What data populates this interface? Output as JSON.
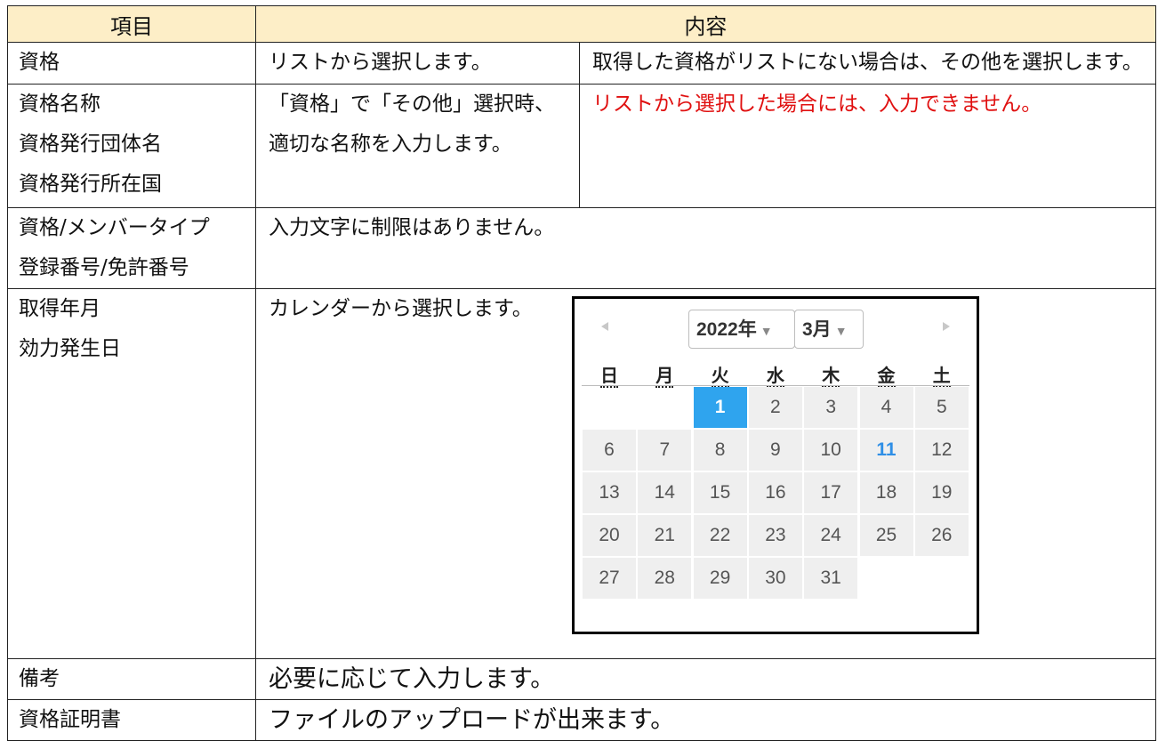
{
  "headers": {
    "item": "項目",
    "content": "内容"
  },
  "rows": {
    "qual": {
      "label": "資格",
      "desc": "リストから選択します。",
      "note": "取得した資格がリストにない場合は、その他を選択します。"
    },
    "names": {
      "labels": [
        "資格名称",
        "資格発行団体名",
        "資格発行所在国"
      ],
      "desc": [
        "「資格」で「その他」選択時、",
        "適切な名称を入力します。"
      ],
      "note": "リストから選択した場合には、入力できません。"
    },
    "member": {
      "labels": [
        "資格/メンバータイプ",
        "登録番号/免許番号"
      ],
      "desc": "入力文字に制限はありません。"
    },
    "date": {
      "labels": [
        "取得年月",
        "効力発生日"
      ],
      "desc": "カレンダーから選択します。"
    },
    "remarks": {
      "label": "備考",
      "desc": "必要に応じて入力します。"
    },
    "cert": {
      "label": "資格証明書",
      "desc": "ファイルのアップロードが出来ます。"
    }
  },
  "calendar": {
    "year": "2022年",
    "month": "3月",
    "weekdays": [
      "日",
      "月",
      "火",
      "水",
      "木",
      "金",
      "土"
    ],
    "first_weekday_index": 2,
    "days_in_month": 31,
    "selected_day": 1,
    "highlighted_day": 11,
    "colors": {
      "selected_bg": "#2fa4ee",
      "highlight_text": "#2f8fe6",
      "note_red": "#e01010",
      "header_bg": "#fdeec7"
    }
  }
}
